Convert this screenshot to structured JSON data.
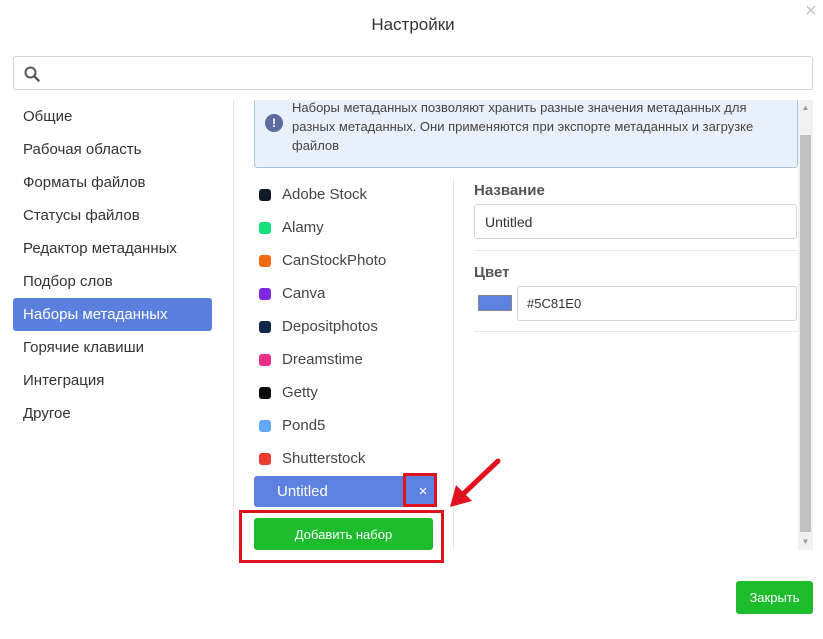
{
  "dialog": {
    "title": "Настройки",
    "close_icon": "close-icon"
  },
  "search": {
    "value": "",
    "placeholder": ""
  },
  "sidebar": {
    "items": [
      {
        "label": "Общие",
        "active": false
      },
      {
        "label": "Рабочая область",
        "active": false
      },
      {
        "label": "Форматы файлов",
        "active": false
      },
      {
        "label": "Статусы файлов",
        "active": false
      },
      {
        "label": "Редактор метаданных",
        "active": false
      },
      {
        "label": "Подбор слов",
        "active": false
      },
      {
        "label": "Наборы метаданных",
        "active": true
      },
      {
        "label": "Горячие клавиши",
        "active": false
      },
      {
        "label": "Интеграция",
        "active": false
      },
      {
        "label": "Другое",
        "active": false
      }
    ]
  },
  "info": {
    "icon": "exclamation-icon",
    "text": "Наборы метаданных позволяют хранить разные значения метаданных для разных метаданных. Они применяются при экспорте метаданных и загрузке файлов"
  },
  "sets": {
    "items": [
      {
        "label": "Adobe Stock",
        "color": "#111827"
      },
      {
        "label": "Alamy",
        "color": "#17e07a"
      },
      {
        "label": "CanStockPhoto",
        "color": "#f06a14"
      },
      {
        "label": "Canva",
        "color": "#7c2be2"
      },
      {
        "label": "Depositphotos",
        "color": "#14264a"
      },
      {
        "label": "Dreamstime",
        "color": "#ef2d86"
      },
      {
        "label": "Getty",
        "color": "#0c0c0c"
      },
      {
        "label": "Pond5",
        "color": "#62a8f4"
      },
      {
        "label": "Shutterstock",
        "color": "#ee3b2e"
      }
    ],
    "active": {
      "label": "Untitled",
      "remove_label": "×"
    },
    "add_label": "Добавить набор"
  },
  "form": {
    "name_label": "Название",
    "name_value": "Untitled",
    "color_label": "Цвет",
    "color_value": "#5C81E0",
    "swatch_color": "#5C81E0"
  },
  "footer": {
    "close_label": "Закрыть"
  },
  "colors": {
    "accent": "#5b7fde",
    "green": "#1cbc2c",
    "annotation_red": "#e0121e"
  }
}
